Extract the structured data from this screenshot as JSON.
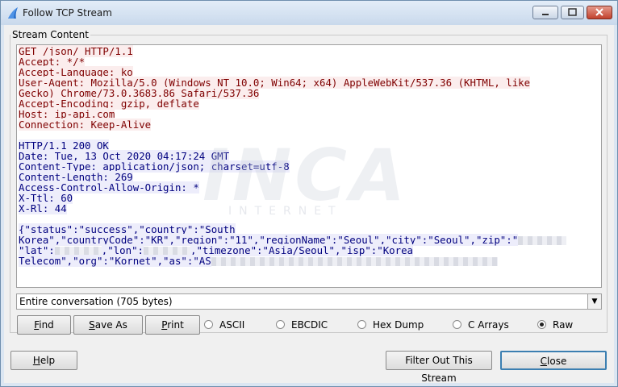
{
  "window": {
    "title": "Follow TCP Stream"
  },
  "group": {
    "label": "Stream Content"
  },
  "stream": {
    "request_lines": [
      "GET /json/ HTTP/1.1",
      "Accept: */*",
      "Accept-Language: ko",
      "User-Agent: Mozilla/5.0 (Windows NT 10.0; Win64; x64) AppleWebKit/537.36 (KHTML, like",
      "Gecko) Chrome/73.0.3683.86 Safari/537.36",
      "Accept-Encoding: gzip, deflate",
      "Host: ip-api.com",
      "Connection: Keep-Alive"
    ],
    "response_lines": [
      "HTTP/1.1 200 OK",
      "Date: Tue, 13 Oct 2020 04:17:24 GMT",
      "Content-Type: application/json; charset=utf-8",
      "Content-Length: 269",
      "Access-Control-Allow-Origin: *",
      "X-Ttl: 60",
      "X-Rl: 44"
    ],
    "json_line1": "{\"status\":\"success\",\"country\":\"South",
    "json_line2": "Korea\",\"countryCode\":\"KR\",\"region\":\"11\",\"regionName\":\"Seoul\",\"city\":\"Seoul\",\"zip\":\"",
    "json_line3a": "\"lat\":",
    "json_line3b": ",\"lon\":",
    "json_line3c": ",\"timezone\":\"Asia/Seoul\",\"isp\":\"Korea",
    "json_line4a": "Telecom\",\"org\":\"Kornet\",\"as\":\"AS",
    "watermark": "INCA",
    "watermark_sub": "INTERNET"
  },
  "conversation_select": {
    "value": "Entire conversation (705 bytes)"
  },
  "buttons": {
    "find": "Find",
    "save_as": "Save As",
    "print": "Print",
    "help": "Help",
    "filter_out": "Filter Out This Stream",
    "close": "Close"
  },
  "format_options": [
    {
      "label": "ASCII",
      "selected": false
    },
    {
      "label": "EBCDIC",
      "selected": false
    },
    {
      "label": "Hex Dump",
      "selected": false
    },
    {
      "label": "C Arrays",
      "selected": false
    },
    {
      "label": "Raw",
      "selected": true
    }
  ],
  "colors": {
    "request_text": "#7f0000",
    "response_text": "#00007f"
  }
}
